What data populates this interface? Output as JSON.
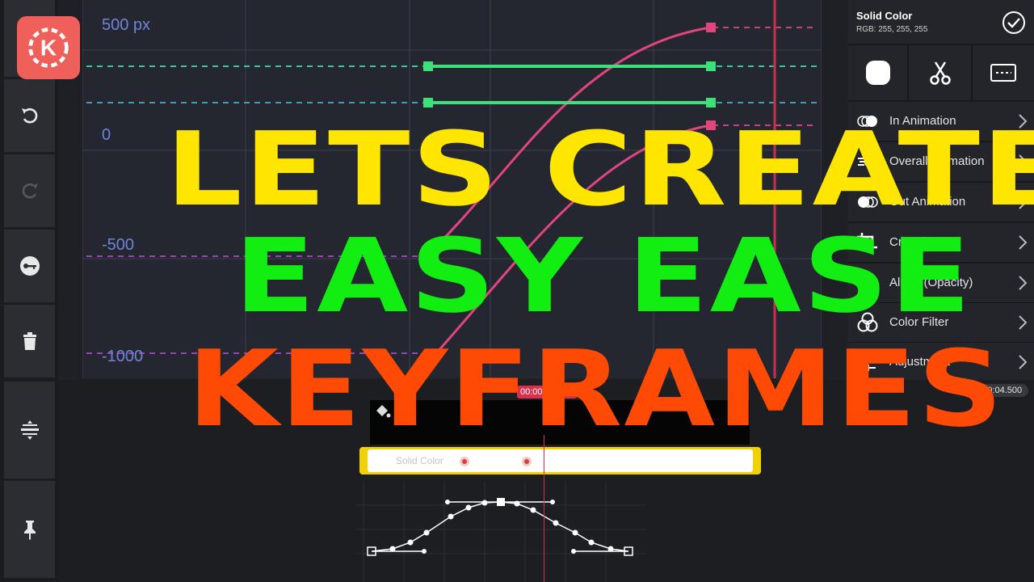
{
  "app": {
    "logo_letter": "K",
    "brand_color": "#f0605a"
  },
  "left_tools": [
    {
      "name": "undo-icon"
    },
    {
      "name": "redo-icon"
    },
    {
      "name": "keyframe-key-icon"
    },
    {
      "name": "delete-icon"
    },
    {
      "name": "split-track-icon"
    },
    {
      "name": "pin-icon"
    }
  ],
  "graph": {
    "axis_labels": [
      "500 px",
      "0",
      "-500",
      "-1000"
    ],
    "curve_color": "#e0457b",
    "handle_color": "#3ee07a",
    "playhead_color": "#c8304e"
  },
  "panel": {
    "title": "Solid Color",
    "rgb": "RGB: 255, 255, 255",
    "tools": [
      "shape-icon",
      "scissors-icon",
      "dashed-rect-icon"
    ],
    "items": [
      {
        "label": "In Animation",
        "icon": "in-animation-icon"
      },
      {
        "label": "Overall Animation",
        "icon": "overall-animation-icon"
      },
      {
        "label": "Out Animation",
        "icon": "out-animation-icon"
      },
      {
        "label": "Cropping",
        "icon": "crop-icon"
      },
      {
        "label": "Alpha (Opacity)",
        "icon": "opacity-icon"
      },
      {
        "label": "Color Filter",
        "icon": "color-filter-icon"
      },
      {
        "label": "Adjustment",
        "icon": "adjustment-icon"
      }
    ]
  },
  "timeline": {
    "time": "00:00:04.500",
    "current_time_partial": "00:00",
    "clip_label": "Solid Color",
    "track_color": "#f1d200"
  },
  "overlay": {
    "line1": "LETS CREATE",
    "line2": "EASY EASE",
    "line3": "KEYFRAMES"
  }
}
